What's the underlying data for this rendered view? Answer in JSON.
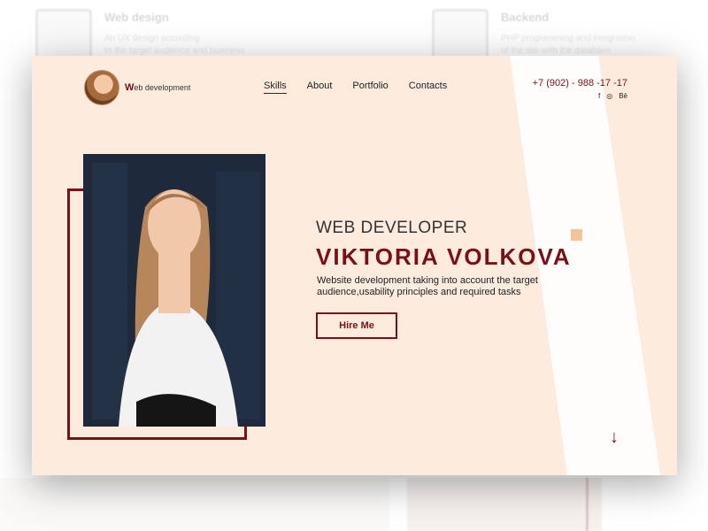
{
  "background": {
    "cards": [
      {
        "title": "Web design",
        "line1": "An UX design according",
        "line2": "to the target audience and business"
      },
      {
        "title": "Backend",
        "line1": "PHP programming and integration",
        "line2": "of the site with the database"
      }
    ]
  },
  "header": {
    "logo_text": "eb development",
    "logo_initial": "W",
    "nav": [
      {
        "label": "Skills",
        "active": true
      },
      {
        "label": "About",
        "active": false
      },
      {
        "label": "Portfolio",
        "active": false
      },
      {
        "label": "Contacts",
        "active": false
      }
    ],
    "phone": "+7 (902) - 988 -17 -17",
    "socials": [
      "facebook-icon",
      "instagram-icon",
      "behance-icon"
    ],
    "social_glyphs": [
      "f",
      "◎",
      "Bē"
    ]
  },
  "hero": {
    "role": "WEB DEVELOPER",
    "name": "VIKTORIA VOLKOVA",
    "description": "Website development taking into account the target audience,usability principles and required tasks",
    "button_label": "Hire Me",
    "scroll_glyph": "↓"
  },
  "colors": {
    "accent": "#7a1016",
    "card_bg": "#fdebde",
    "accent_square": "#f4c198"
  }
}
